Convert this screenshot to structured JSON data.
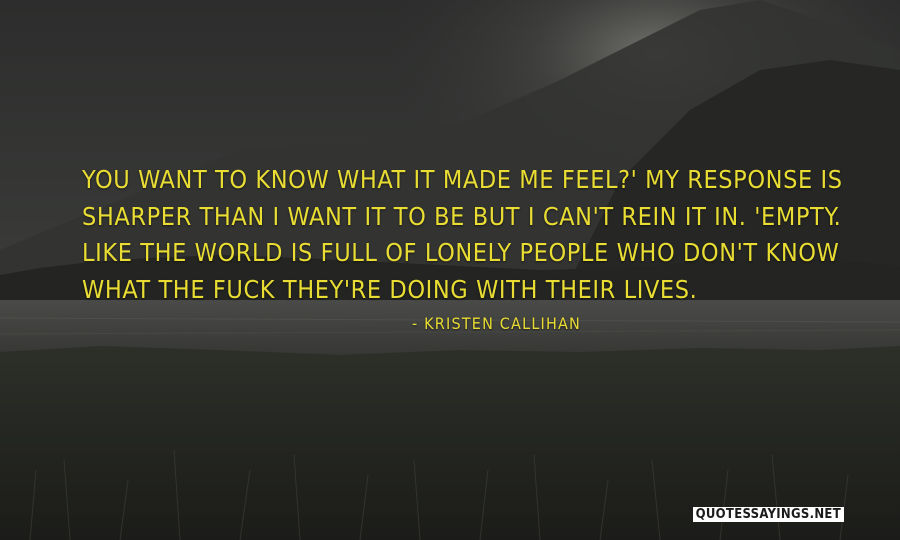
{
  "colors": {
    "text": "#e9dd33",
    "watermark_bg": "#ffffff",
    "watermark_text": "#1b1b1b"
  },
  "quote": {
    "lines": [
      "YOU WANT TO KNOW WHAT IT MADE ME FEEL?' MY RESPONSE IS",
      "SHARPER THAN I WANT IT TO BE BUT I CAN'T REIN IT IN. 'EMPTY.",
      "LIKE THE WORLD IS FULL OF LONELY PEOPLE WHO DON'T KNOW",
      "WHAT THE FUCK THEY'RE DOING WITH THEIR LIVES."
    ]
  },
  "author": "- KRISTEN CALLIHAN",
  "watermark": "QUOTESSAYINGS.NET"
}
